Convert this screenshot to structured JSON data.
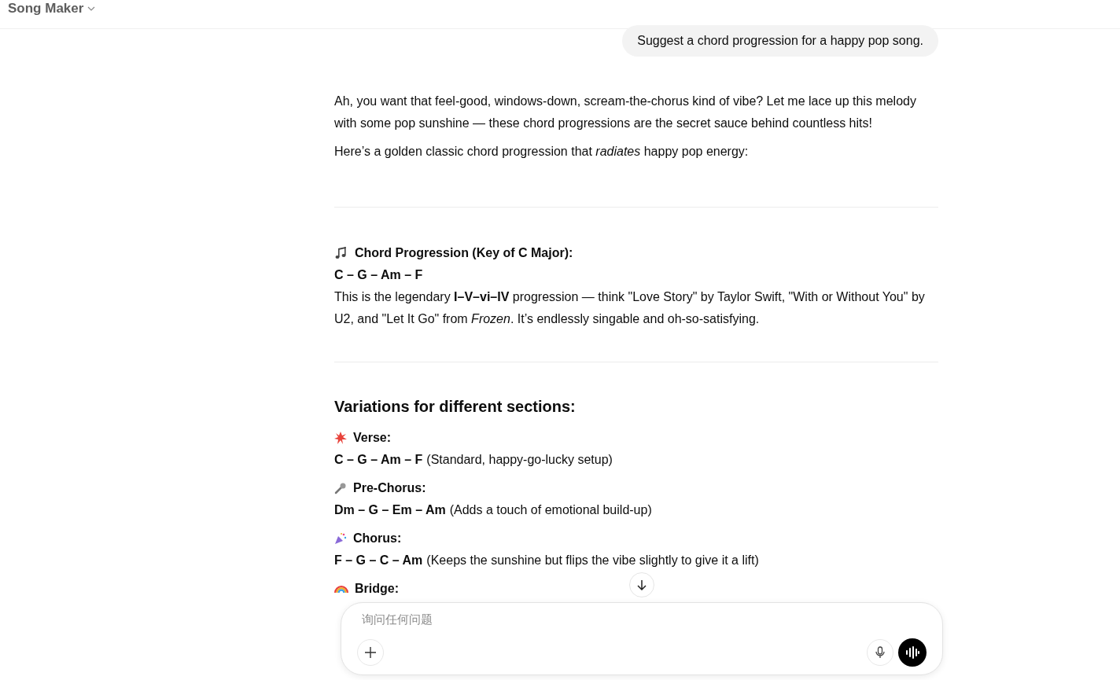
{
  "header": {
    "title": "Song Maker"
  },
  "user_message": "Suggest a chord progression for a happy pop song.",
  "intro": [
    "Ah, you want that feel-good, windows-down, scream-the-chorus kind of vibe? Let me lace up this melody with some pop sunshine — these chord progressions are the secret sauce behind countless hits!",
    "Here’s a golden classic chord progression that *radiates* happy pop energy:"
  ],
  "main_progression": {
    "title": "Chord Progression (Key of C Major):",
    "chords": "C – G – Am – F",
    "description": "This is the legendary **I–V–vi–IV** progression — think \"Love Story\" by Taylor Swift, \"With or Without You\" by U2, and \"Let It Go\" from *Frozen*. It’s endlessly singable and oh-so-satisfying."
  },
  "variations": {
    "heading": "Variations for different sections:",
    "sections": [
      {
        "label": "Verse:",
        "chords": "C – G – Am – F",
        "note": "(Standard, happy-go-lucky setup)"
      },
      {
        "label": "Pre-Chorus:",
        "chords": "Dm – G – Em – Am",
        "note": "(Adds a touch of emotional build-up)"
      },
      {
        "label": "Chorus:",
        "chords": "F – G – C – Am",
        "note": "(Keeps the sunshine but flips the vibe slightly to give it a lift)"
      },
      {
        "label": "Bridge:"
      }
    ]
  },
  "composer": {
    "placeholder": "询问任何问题"
  }
}
